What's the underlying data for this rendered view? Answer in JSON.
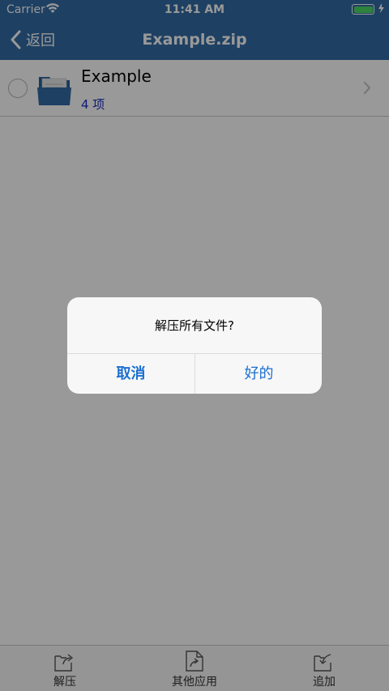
{
  "status_bar": {
    "carrier": "Carrier",
    "time": "11:41 AM"
  },
  "nav": {
    "back_label": "返回",
    "title": "Example.zip"
  },
  "file_list": [
    {
      "name": "Example",
      "count": "4 项"
    }
  ],
  "toolbar": {
    "extract_label": "解压",
    "share_label": "其他应用",
    "add_label": "追加"
  },
  "alert": {
    "message": "解压所有文件?",
    "cancel_label": "取消",
    "ok_label": "好的"
  },
  "colors": {
    "nav_bar": "#336ba5",
    "count_text": "#1a2dc4",
    "alert_button": "#1b6fd1",
    "battery": "#4cd964"
  }
}
